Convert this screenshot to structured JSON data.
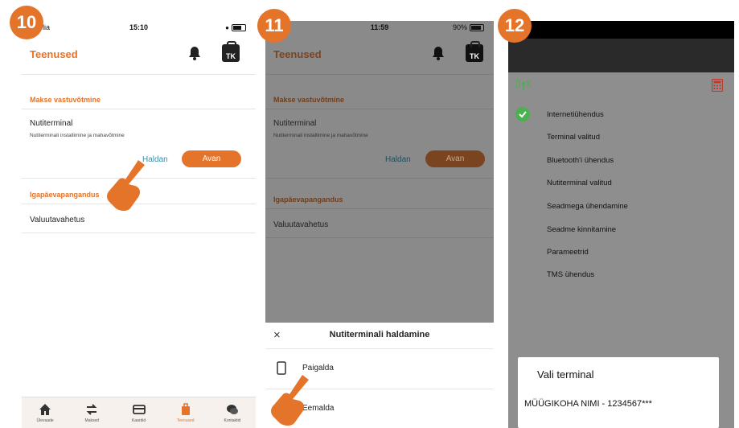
{
  "colors": {
    "accent": "#e5742b",
    "link": "#3a8fa5",
    "success": "#4caf50",
    "overlay": "#8a8a8a"
  },
  "panel1": {
    "badge": "10",
    "status": {
      "carrier": "lia",
      "time": "15:10"
    },
    "title": "Teenused",
    "icons": {
      "bell": "bell-icon",
      "profile": "tk-bag-icon"
    },
    "profile_initials": "TK",
    "section1": "Makse vastuvõtmine",
    "item_title": "Nutiterminal",
    "item_sub": "Nutiterminali installimine ja mahavõtmine",
    "manage_label": "Haldan",
    "open_label": "Avan",
    "section2": "Igapäevapangandus",
    "item2": "Valuutavahetus",
    "tabs": [
      {
        "label": "Ülevaade",
        "icon": "home-icon"
      },
      {
        "label": "Maksed",
        "icon": "transfer-icon"
      },
      {
        "label": "Kaardid",
        "icon": "card-icon"
      },
      {
        "label": "Teenused",
        "icon": "services-icon",
        "active": true
      },
      {
        "label": "Kontaktid",
        "icon": "chat-icon"
      }
    ]
  },
  "panel2": {
    "badge": "11",
    "status": {
      "carrier": "a",
      "time": "11:59",
      "battery": "90%"
    },
    "title": "Teenused",
    "profile_initials": "TK",
    "section1": "Makse vastuvõtmine",
    "item_title": "Nutiterminal",
    "item_sub": "Nutiterminali installimine ja mahavõtmine",
    "manage_label": "Haldan",
    "open_label": "Avan",
    "section2": "Igapäevapangandus",
    "item2": "Valuutavahetus",
    "sheet": {
      "close": "×",
      "title": "Nutiterminali haldamine",
      "options": [
        {
          "label": "Paigalda",
          "icon": "phone-install-icon"
        },
        {
          "label": "Eemalda",
          "icon": "phone-remove-icon"
        }
      ]
    }
  },
  "panel3": {
    "badge": "12",
    "steps": [
      {
        "label": "Internetiühendus",
        "done": true
      },
      {
        "label": "Terminal valitud",
        "done": false
      },
      {
        "label": "Bluetooth'i ühendus",
        "done": false
      },
      {
        "label": "Nutiterminal valitud",
        "done": false
      },
      {
        "label": "Seadmega ühendamine",
        "done": false
      },
      {
        "label": "Seadme kinnitamine",
        "done": false
      },
      {
        "label": "Parameetrid",
        "done": false
      },
      {
        "label": "TMS ühendus",
        "done": false
      }
    ],
    "dialog": {
      "title": "Vali terminal",
      "value": "MÜÜGIKOHA NIMI - 1234567***"
    }
  }
}
